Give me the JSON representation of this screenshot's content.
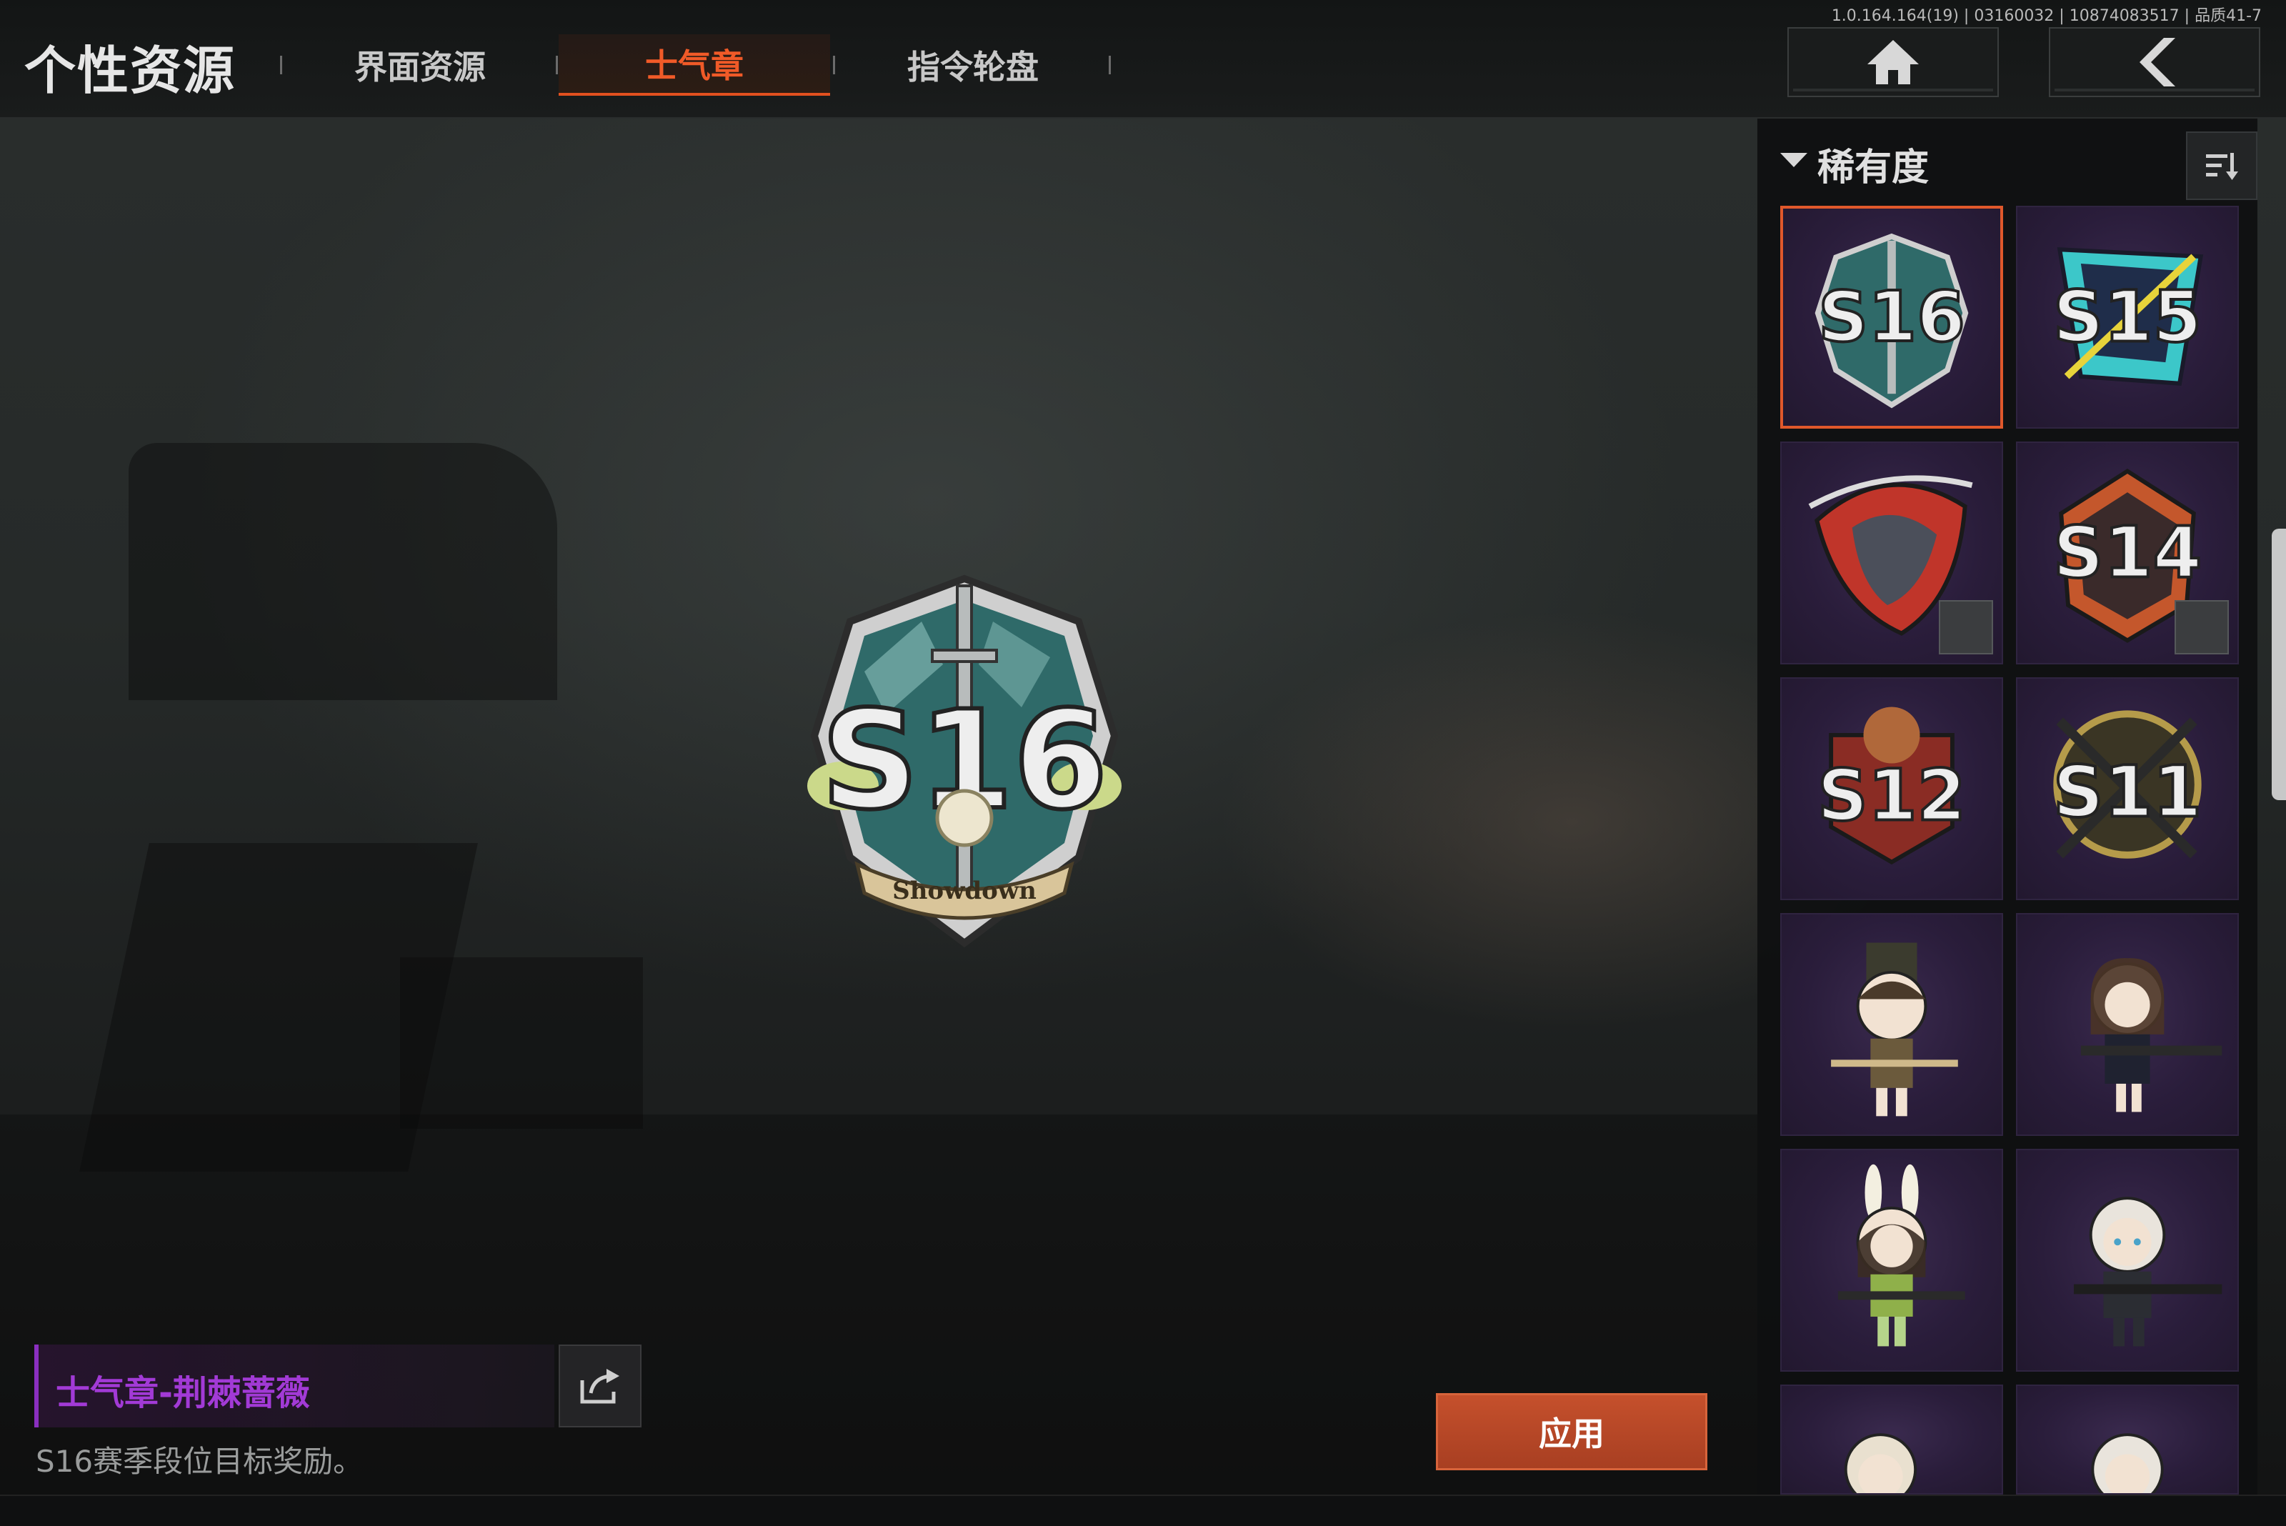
{
  "version": "1.0.164.164(19) | 03160032 | 10874083517 | 品质41-7",
  "header": {
    "title": "个性资源",
    "tabs": [
      {
        "label": "界面资源",
        "active": false
      },
      {
        "label": "士气章",
        "active": true
      },
      {
        "label": "指令轮盘",
        "active": false
      }
    ],
    "home_icon": "home-icon",
    "back_icon": "back-arrow-icon"
  },
  "preview": {
    "badge_text": "S16",
    "badge_ribbon": "Showdown"
  },
  "item": {
    "name": "士气章-荆棘蔷薇",
    "description": "S16赛季段位目标奖励。",
    "name_color": "#a23ad6"
  },
  "apply_label": "应用",
  "panel": {
    "filter_label": "稀有度",
    "sort_icon": "sort-icon",
    "items": [
      {
        "label": "S16",
        "selected": true
      },
      {
        "label": "S15",
        "selected": false
      },
      {
        "label": "",
        "selected": false
      },
      {
        "label": "S14",
        "selected": false
      },
      {
        "label": "S12",
        "selected": false
      },
      {
        "label": "S11",
        "selected": false
      },
      {
        "label": "",
        "selected": false
      },
      {
        "label": "",
        "selected": false
      },
      {
        "label": "",
        "selected": false
      },
      {
        "label": "",
        "selected": false
      },
      {
        "label": "",
        "selected": false
      },
      {
        "label": "",
        "selected": false
      }
    ]
  },
  "colors": {
    "accent": "#e2501f",
    "rare_purple": "#8a2fc0"
  }
}
